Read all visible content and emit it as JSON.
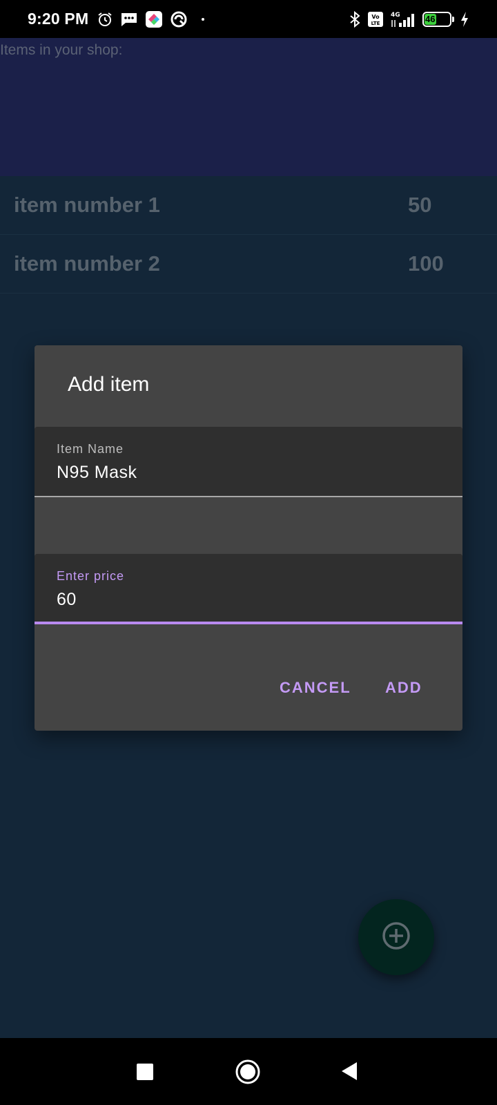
{
  "status_bar": {
    "time": "9:20 PM",
    "left_icons": [
      "alarm-icon",
      "message-icon",
      "app-icon",
      "vpn-icon",
      "dot-icon"
    ],
    "right_icons": [
      "bluetooth-icon",
      "volte-icon",
      "signal-4g-icon",
      "battery-icon",
      "charging-icon"
    ],
    "network": "4G",
    "volte": "Vo LTE",
    "battery_level": "46"
  },
  "header": {
    "label": "Items in your shop:"
  },
  "items": [
    {
      "name": "item number 1",
      "price": "50"
    },
    {
      "name": "item number 2",
      "price": "100"
    }
  ],
  "dialog": {
    "title": "Add item",
    "name_field": {
      "label": "Item Name",
      "value": "N95 Mask"
    },
    "price_field": {
      "label": "Enter price",
      "value": "60"
    },
    "cancel_label": "CANCEL",
    "add_label": "ADD"
  },
  "fab": {
    "icon": "add-circle-icon"
  },
  "nav_bar": {
    "buttons": [
      "recents-icon",
      "home-icon",
      "back-icon"
    ]
  },
  "colors": {
    "background": "#132638",
    "header": "#1b2049",
    "dialog": "#444444",
    "accent": "#c49af5",
    "fab": "#03251f"
  }
}
